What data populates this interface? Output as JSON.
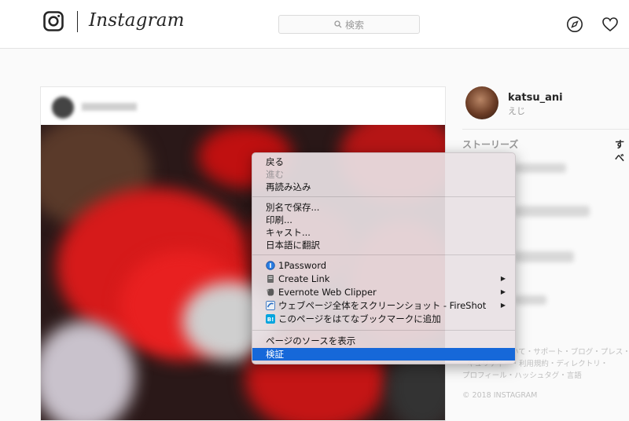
{
  "app": {
    "brand": "Instagram"
  },
  "search": {
    "placeholder": "検索"
  },
  "profile": {
    "username": "katsu_ani",
    "display_name": "えじ"
  },
  "stories": {
    "label": "ストーリーズ",
    "view_all": "すべ"
  },
  "footer": {
    "line1": "いて・サポート・ブログ・プレス・AP",
    "line2": "キュリティー・利用規約・ディレクトリ・",
    "line3": "プロフィール・ハッシュタグ・言語",
    "copyright": "© 2018 INSTAGRAM"
  },
  "context_menu": {
    "back": "戻る",
    "forward": "進む",
    "reload": "再読み込み",
    "save_as": "別名で保存...",
    "print": "印刷...",
    "cast": "キャスト...",
    "translate": "日本語に翻訳",
    "onepassword": "1Password",
    "create_link": "Create Link",
    "evernote": "Evernote Web Clipper",
    "fireshot": "ウェブページ全体をスクリーンショット - FireShot",
    "hatena": "このページをはてなブックマークに追加",
    "hatena_icon": "B!",
    "view_source": "ページのソースを表示",
    "inspect": "検証",
    "submenu_arrow": "▶"
  },
  "colors": {
    "highlight": "#1668d9",
    "menu_bg": "#e8e1e4",
    "accent_red": "#d01818"
  }
}
